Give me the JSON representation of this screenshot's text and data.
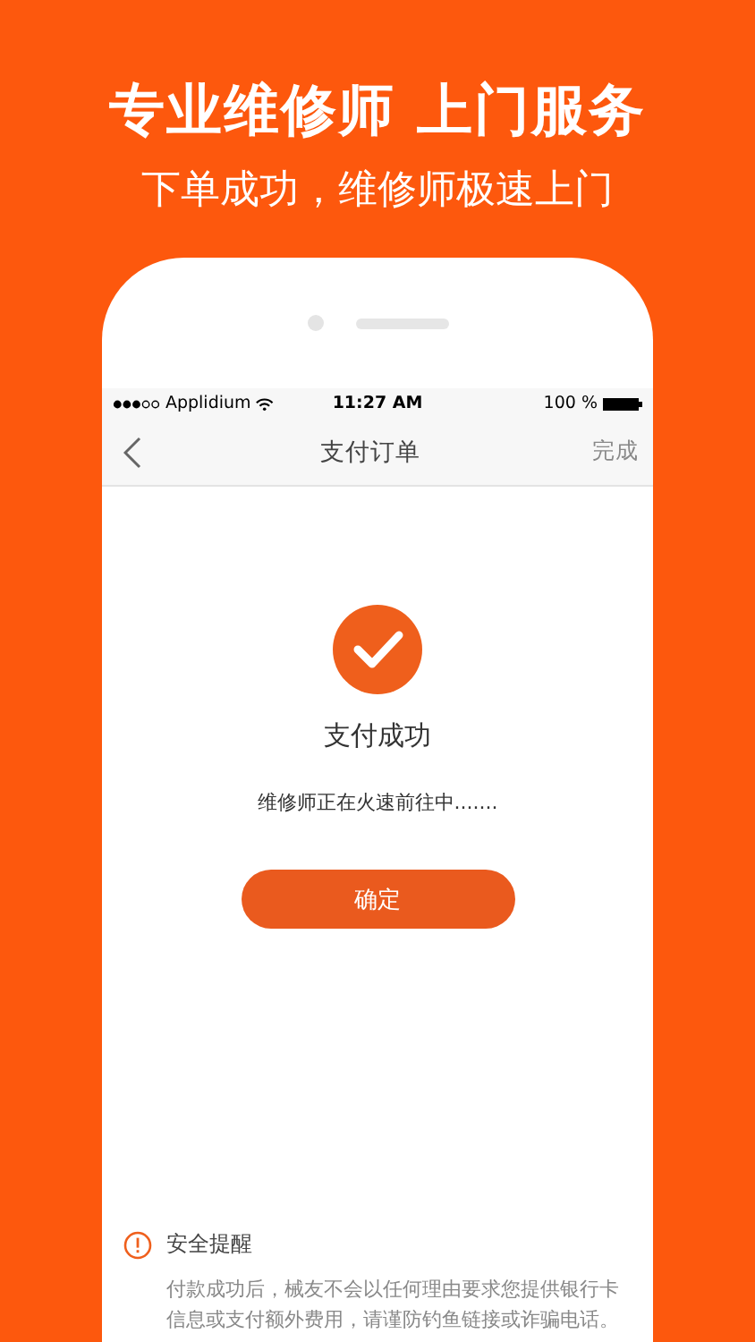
{
  "headline": "专业维修师 上门服务",
  "subheadline": "下单成功，维修师极速上门",
  "status_bar": {
    "carrier": "Applidium",
    "time": "11:27 AM",
    "battery": "100 %"
  },
  "nav": {
    "title": "支付订单",
    "action": "完成"
  },
  "result": {
    "title": "支付成功",
    "message": "维修师正在火速前往中.......",
    "button": "确定"
  },
  "notice": {
    "title": "安全提醒",
    "text": "付款成功后，械友不会以任何理由要求您提供银行卡信息或支付额外费用，请谨防钓鱼链接或诈骗电话。"
  }
}
